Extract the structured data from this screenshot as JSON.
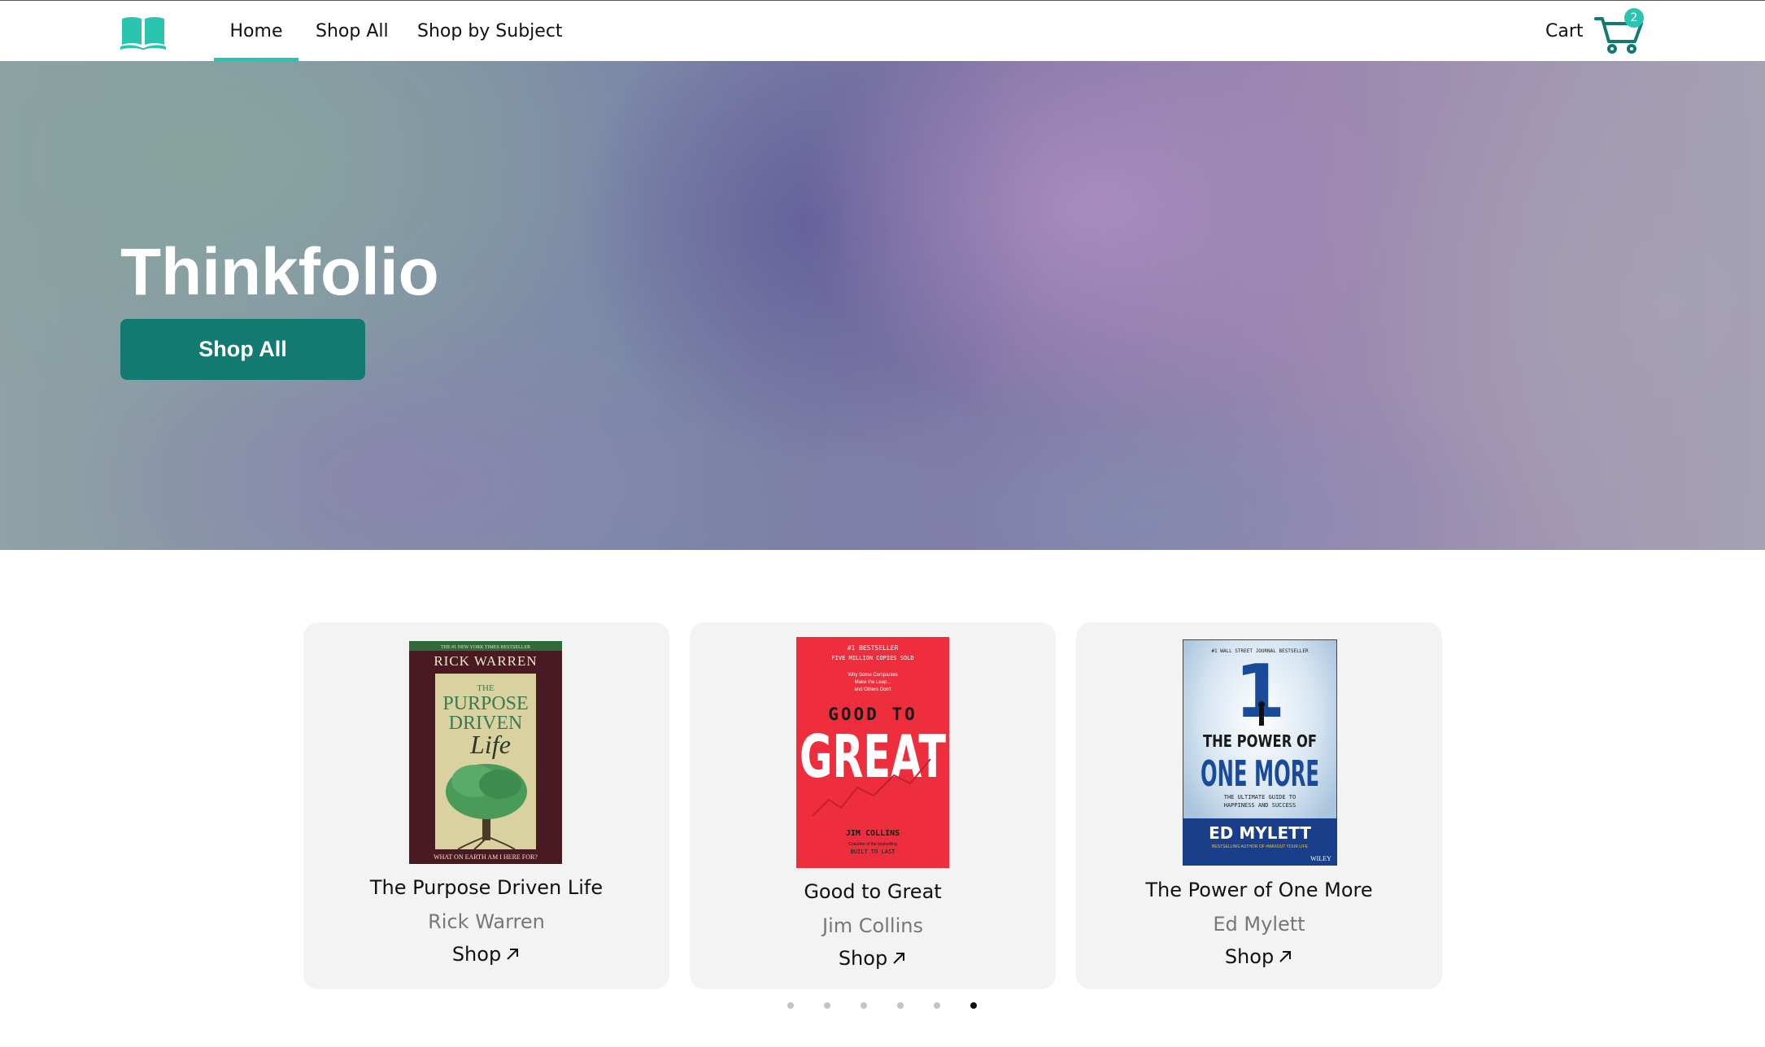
{
  "nav": {
    "logo_icon": "open-book-icon",
    "items": [
      {
        "label": "Home",
        "active": true
      },
      {
        "label": "Shop All",
        "active": false
      },
      {
        "label": "Shop by Subject",
        "active": false
      }
    ],
    "cart_label": "Cart",
    "cart_icon": "shopping-cart-icon",
    "cart_count": "2"
  },
  "hero": {
    "title": "Thinkfolio",
    "button_label": "Shop All"
  },
  "carousel": {
    "books": [
      {
        "title": "The Purpose Driven Life",
        "author": "Rick Warren",
        "link_label": "Shop",
        "cover": {
          "top_line": "THE #1 NEW YORK TIMES BESTSELLER",
          "author_line": "RICK WARREN",
          "title_small": "THE",
          "title_line1": "PURPOSE",
          "title_line2": "DRIVEN",
          "title_line3": "Life",
          "bottom_line": "WHAT ON EARTH AM I HERE FOR?"
        }
      },
      {
        "title": "Good to Great",
        "author": "Jim Collins",
        "link_label": "Shop",
        "cover": {
          "top_line1": "#1 BESTSELLER",
          "top_line2": "FIVE MILLION COPIES SOLD",
          "tagline1": "Why Some Companies",
          "tagline2": "Make the Leap...",
          "tagline3": "and Others Don't",
          "title_line1": "GOOD TO",
          "title_line2": "GREAT",
          "author_line": "JIM COLLINS",
          "credit_line1": "Coauthor of the bestselling",
          "credit_line2": "BUILT TO LAST"
        }
      },
      {
        "title": "The Power of One More",
        "author": "Ed Mylett",
        "link_label": "Shop",
        "cover": {
          "top_line": "#1 WALL STREET JOURNAL BESTSELLER",
          "big_number": "1",
          "title_line1": "THE POWER OF",
          "title_line2": "ONE MORE",
          "subtitle1": "THE ULTIMATE GUIDE TO",
          "subtitle2": "HAPPINESS AND SUCCESS",
          "author_line": "ED MYLETT",
          "credit_line": "BESTSELLING AUTHOR OF #MAXOUT YOUR LIFE",
          "publisher": "WILEY"
        }
      }
    ],
    "link_icon": "arrow-up-right-icon",
    "dot_count": 6,
    "active_dot": 6
  },
  "colors": {
    "accent": "#2bc4b0",
    "button": "#137a72",
    "card_bg": "#f3f3f3"
  }
}
